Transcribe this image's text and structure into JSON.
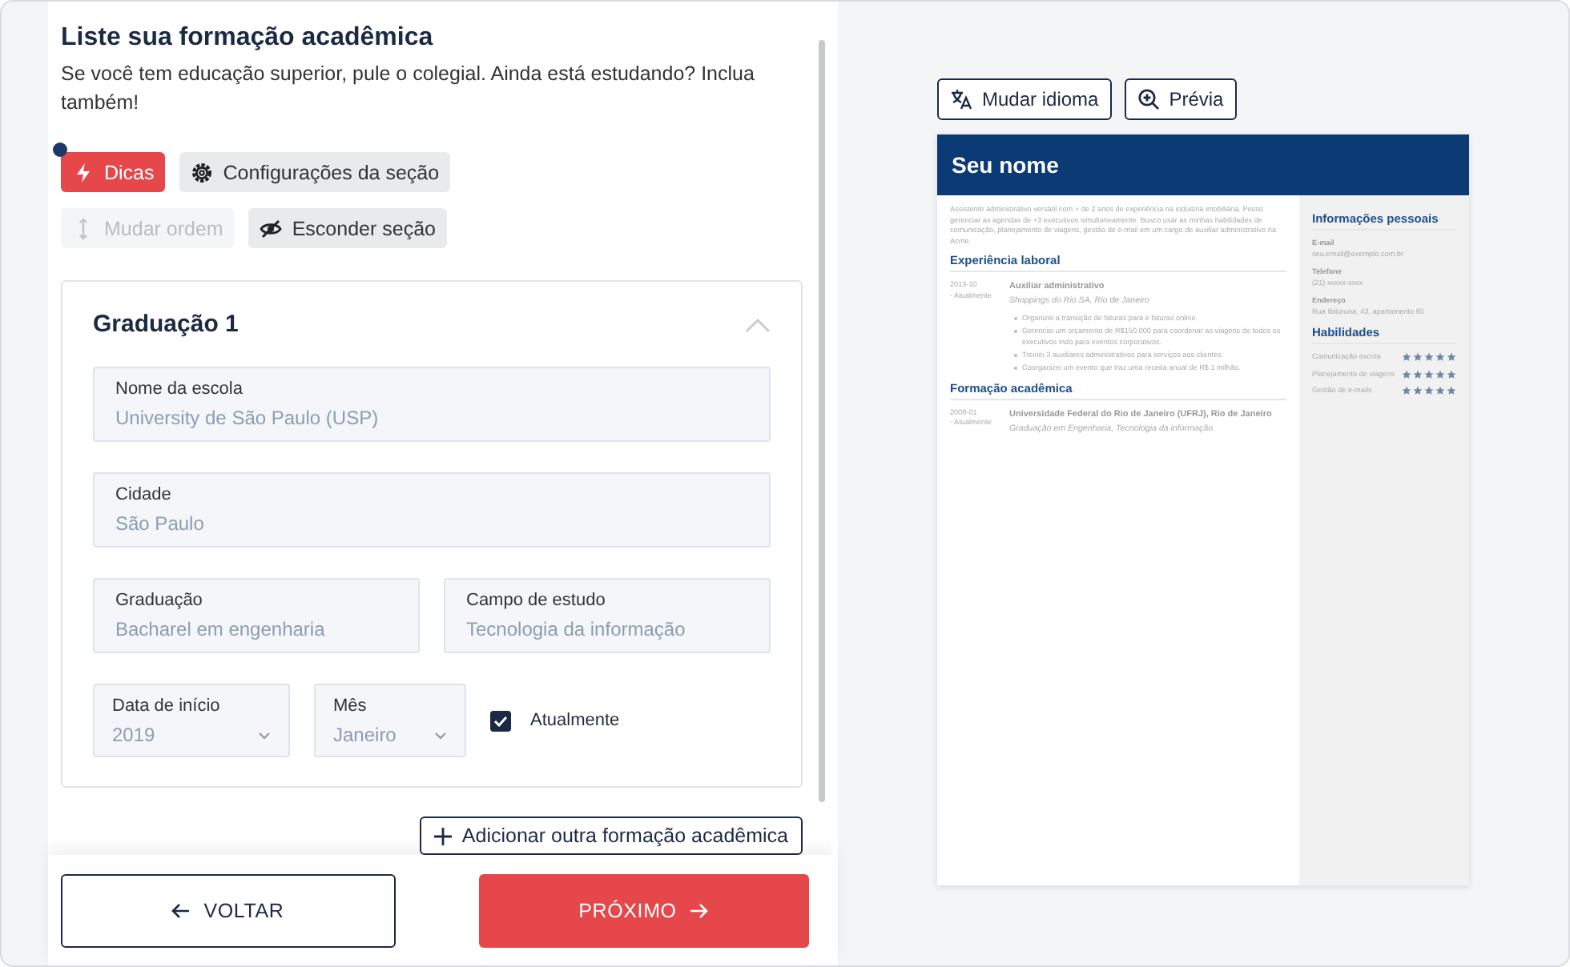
{
  "header": {
    "title": "Liste sua formação acadêmica",
    "subtitle": "Se você tem educação superior, pule o colegial. Ainda está estudando? Inclua também!"
  },
  "toolbar": [
    {
      "kind": "tips",
      "label": "Dicas",
      "disabled": false,
      "badge": true
    },
    {
      "kind": "settings",
      "label": "Configurações da seção",
      "disabled": false,
      "badge": false
    },
    {
      "kind": "order",
      "label": "Mudar ordem",
      "disabled": true,
      "badge": false
    },
    {
      "kind": "hide",
      "label": "Esconder seção",
      "disabled": false,
      "badge": false
    }
  ],
  "education": {
    "title": "Graduação 1",
    "expanded": true,
    "rows": [
      {
        "fields": [
          {
            "kind": "text",
            "label": "Nome da escola",
            "placeholder": "University de São Paulo (USP)"
          }
        ]
      },
      {
        "fields": [
          {
            "kind": "text",
            "label": "Cidade",
            "placeholder": "São Paulo"
          }
        ]
      },
      {
        "fields": [
          {
            "kind": "text",
            "label": "Graduação",
            "placeholder": "Bacharel em engenharia"
          },
          {
            "kind": "text",
            "label": "Campo de estudo",
            "placeholder": "Tecnologia da informação"
          }
        ]
      },
      {
        "fields": [
          {
            "kind": "select",
            "label": "Data de início",
            "placeholder": "2019"
          },
          {
            "kind": "select",
            "label": "Mês",
            "placeholder": "Janeiro"
          },
          {
            "kind": "checkbox",
            "label": "Atualmente",
            "checked": true
          }
        ]
      }
    ]
  },
  "add_button": "Adicionar outra formação acadêmica",
  "footer": {
    "back": "VOLTAR",
    "next": "PRÓXIMO"
  },
  "preview": {
    "actions": [
      {
        "kind": "language",
        "label": "Mudar idioma"
      },
      {
        "kind": "preview",
        "label": "Prévia"
      }
    ],
    "resume": {
      "name": "Seu nome",
      "summary": "Assistente administrativo versátil com + de 2 anos de experiência na indústria imobiliária. Posso gerenciar as agendas de +3 executivos simultaneamente. Busco usar as minhas habilidades de comunicação, planejamento de viagens, gestão de e-mail em um cargo de auxiliar administrativo na Acme.",
      "sections": [
        {
          "title": "Experiência laboral",
          "entries": [
            {
              "start": "2013-10",
              "end": "- Atualmente",
              "title": "Auxiliar administrativo",
              "subtitle": "Shoppings do Rio SA, Rio de Janeiro",
              "bullets": [
                "Organizei a transição de faturas para e faturas online.",
                "Gerenciei um orçamento de R$150.000 para coordenar as viagens de todos os executivos indo para eventos corporativos.",
                "Treinei 3 auxiliares administrativos para serviços aos clientes.",
                "Coorganizei um evento que traz uma receita anual de R$ 1 milhão."
              ]
            }
          ]
        },
        {
          "title": "Formação acadêmica",
          "entries": [
            {
              "start": "2008-01",
              "end": "- Atualmente",
              "title": "Universidade Federal do Rio de Janeiro (UFRJ), Rio de Janeiro",
              "subtitle": "Graduação em Engenharia, Tecnologia da informação"
            }
          ]
        }
      ],
      "personal": {
        "title": "Informações pessoais",
        "items": [
          {
            "label": "E-mail",
            "value": "seu.email@exemplo.com.br"
          },
          {
            "label": "Telefone",
            "value": "(21) xxxxx-xxxx"
          },
          {
            "label": "Endereço",
            "value": "Rua Ibituruna, 43, apartamento 65"
          }
        ]
      },
      "skills": {
        "title": "Habilidades",
        "items": [
          {
            "name": "Comunicação escrita",
            "stars": 5
          },
          {
            "name": "Planejamento de viagens",
            "stars": 5
          },
          {
            "name": "Gestão de e-mails",
            "stars": 5
          }
        ]
      }
    }
  }
}
